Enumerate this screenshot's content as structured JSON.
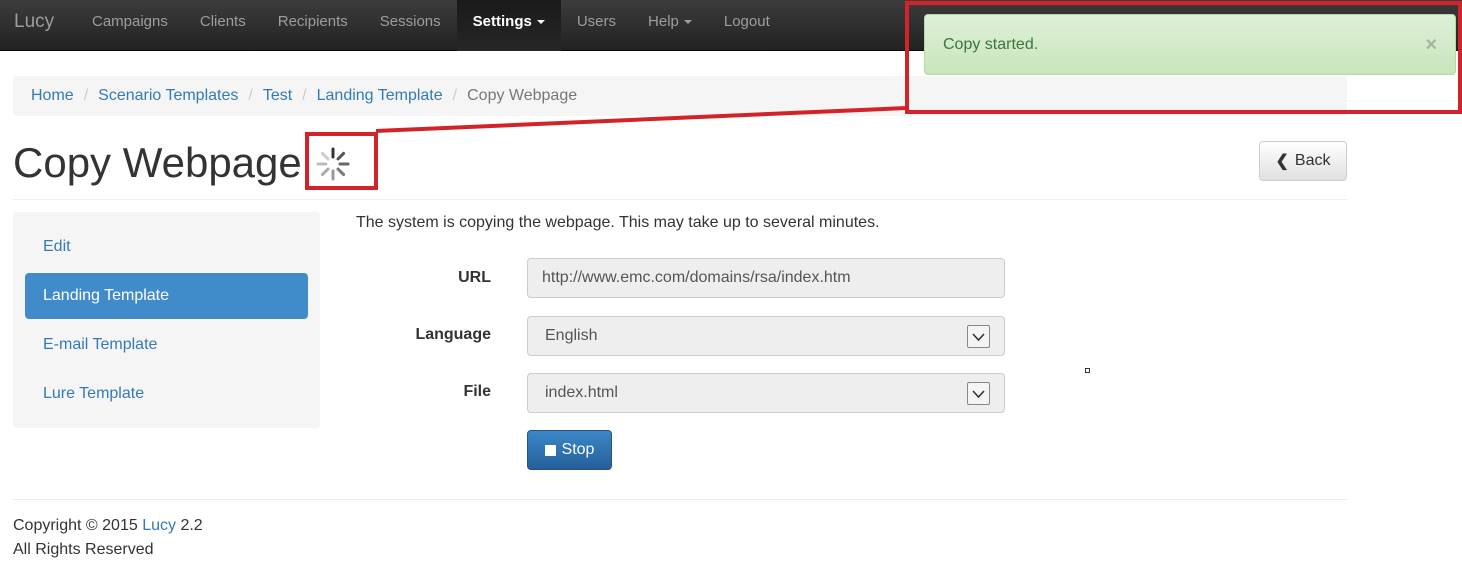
{
  "navbar": {
    "brand": "Lucy",
    "items": [
      {
        "label": "Campaigns"
      },
      {
        "label": "Clients"
      },
      {
        "label": "Recipients"
      },
      {
        "label": "Sessions"
      },
      {
        "label": "Settings"
      },
      {
        "label": "Users"
      },
      {
        "label": "Help"
      },
      {
        "label": "Logout"
      }
    ]
  },
  "breadcrumb": {
    "items": [
      "Home",
      "Scenario Templates",
      "Test",
      "Landing Template"
    ],
    "active": "Copy Webpage",
    "separator": "/"
  },
  "page": {
    "title": "Copy Webpage",
    "back_label": "Back"
  },
  "sidebar": {
    "items": [
      {
        "label": "Edit"
      },
      {
        "label": "Landing Template"
      },
      {
        "label": "E-mail Template"
      },
      {
        "label": "Lure Template"
      }
    ],
    "active_index": 1
  },
  "form": {
    "intro": "The system is copying the webpage. This may take up to several minutes.",
    "url_label": "URL",
    "url_value": "http://www.emc.com/domains/rsa/index.htm",
    "language_label": "Language",
    "language_value": "English",
    "file_label": "File",
    "file_value": "index.html",
    "stop_label": "Stop"
  },
  "footer": {
    "copyright_prefix": "Copyright © 2015",
    "brand": "Lucy",
    "version": "2.2",
    "rights": "All Rights Reserved"
  },
  "alert": {
    "message": "Copy started.",
    "close_glyph": "×"
  },
  "colors": {
    "accent": "#428bca",
    "link": "#337ab7",
    "annotation": "#d2232a",
    "alert_bg": "#dff0d8"
  }
}
